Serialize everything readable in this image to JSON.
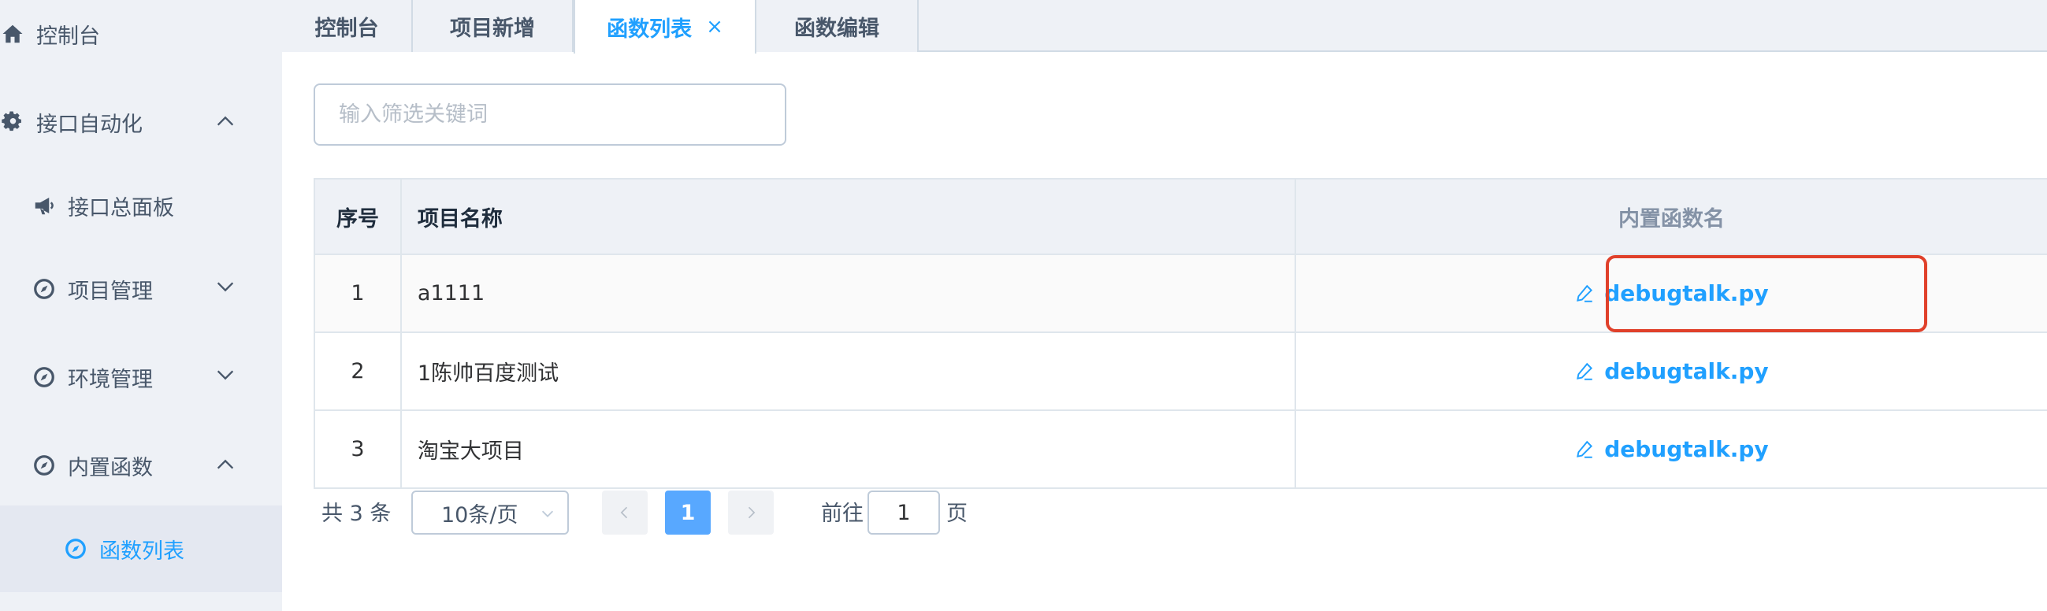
{
  "sidebar": {
    "items": [
      {
        "label": "控制台",
        "icon": "home-icon"
      },
      {
        "label": "接口自动化",
        "icon": "gear-icon",
        "expanded": true
      },
      {
        "label": "接口总面板",
        "icon": "megaphone-icon"
      },
      {
        "label": "项目管理",
        "icon": "compass-icon",
        "expanded": false
      },
      {
        "label": "环境管理",
        "icon": "compass-icon",
        "expanded": false
      },
      {
        "label": "内置函数",
        "icon": "compass-icon",
        "expanded": true
      },
      {
        "label": "函数列表",
        "icon": "compass-icon",
        "active": true
      }
    ]
  },
  "tabs": [
    {
      "label": "控制台"
    },
    {
      "label": "项目新增"
    },
    {
      "label": "函数列表",
      "active": true,
      "close": "×"
    },
    {
      "label": "函数编辑"
    }
  ],
  "filter": {
    "placeholder": "输入筛选关键词",
    "value": ""
  },
  "table": {
    "headers": {
      "index": "序号",
      "name": "项目名称",
      "func": "内置函数名"
    },
    "rows": [
      {
        "index": "1",
        "name": "a1111",
        "func": "debugtalk.py"
      },
      {
        "index": "2",
        "name": "1陈帅百度测试",
        "func": "debugtalk.py"
      },
      {
        "index": "3",
        "name": "淘宝大项目",
        "func": "debugtalk.py"
      }
    ]
  },
  "pagination": {
    "total": "共 3 条",
    "page_size": "10条/页",
    "current_page": "1",
    "goto_label": "前往",
    "goto_value": "1",
    "page_unit": "页"
  },
  "colors": {
    "accent": "#20a0ff",
    "highlight_box": "#e0402a",
    "sidebar_bg": "#eef1f6"
  }
}
